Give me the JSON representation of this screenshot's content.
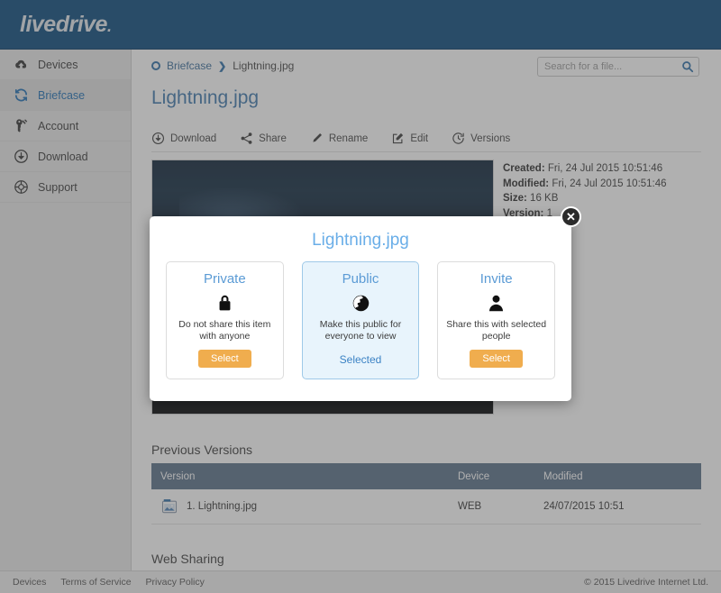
{
  "header": {
    "logo_text": "livedrive",
    "logo_dot": "."
  },
  "sidebar": {
    "items": [
      {
        "label": "Devices",
        "icon": "cloud-upload-icon",
        "active": false
      },
      {
        "label": "Briefcase",
        "icon": "sync-icon",
        "active": true
      },
      {
        "label": "Account",
        "icon": "key-icon",
        "active": false
      },
      {
        "label": "Download",
        "icon": "download-icon",
        "active": false
      },
      {
        "label": "Support",
        "icon": "lifebuoy-icon",
        "active": false
      }
    ]
  },
  "breadcrumb": {
    "root": "Briefcase",
    "separator": "❯",
    "current": "Lightning.jpg"
  },
  "search": {
    "placeholder": "Search for a file...",
    "value": "",
    "icon": "search-icon"
  },
  "page": {
    "title": "Lightning.jpg"
  },
  "toolbar": {
    "items": [
      {
        "label": "Download",
        "icon": "download-circle-icon"
      },
      {
        "label": "Share",
        "icon": "share-nodes-icon"
      },
      {
        "label": "Rename",
        "icon": "pencil-icon"
      },
      {
        "label": "Edit",
        "icon": "edit-square-icon"
      },
      {
        "label": "Versions",
        "icon": "history-clock-icon"
      }
    ]
  },
  "file_info": {
    "created_label": "Created:",
    "created_value": "Fri, 24 Jul 2015 10:51:46",
    "modified_label": "Modified:",
    "modified_value": "Fri, 24 Jul 2015 10:51:46",
    "size_label": "Size:",
    "size_value": "16 KB",
    "version_label": "Version:",
    "version_value": "1"
  },
  "sections": {
    "previous_versions": "Previous Versions",
    "web_sharing": "Web Sharing"
  },
  "versions_table": {
    "columns": [
      "Version",
      "Device",
      "Modified"
    ],
    "rows": [
      {
        "version": "1. Lightning.jpg",
        "device": "WEB",
        "modified": "24/07/2015 10:51",
        "icon": "image-file-icon"
      }
    ]
  },
  "modal": {
    "title": "Lightning.jpg",
    "close_label": "✕",
    "options": [
      {
        "name": "Private",
        "icon": "lock-icon",
        "description": "Do not share this item with anyone",
        "action": "Select",
        "selected": false
      },
      {
        "name": "Public",
        "icon": "globe-icon",
        "description": "Make this public for everyone to view",
        "action": "Selected",
        "selected": true
      },
      {
        "name": "Invite",
        "icon": "person-icon",
        "description": "Share this with selected people",
        "action": "Select",
        "selected": false
      }
    ]
  },
  "footer": {
    "links": [
      "Devices",
      "Terms of Service",
      "Privacy Policy"
    ],
    "copyright": "© 2015 Livedrive Internet Ltd."
  },
  "colors": {
    "header_blue": "#0a4a7d",
    "accent_blue": "#3e78ad",
    "card_title_blue": "#5b9bd5",
    "select_orange": "#f0ad4e",
    "table_header": "#5a7189"
  }
}
